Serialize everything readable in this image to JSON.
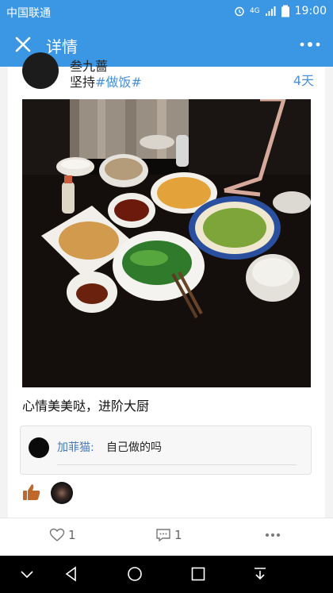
{
  "status_bar": {
    "carrier": "中国联通",
    "time": "19:00",
    "network": "4G"
  },
  "title_bar": {
    "title": "详情"
  },
  "post": {
    "user_name": "叁九蔷",
    "tagline_prefix": "坚持",
    "hashtag": "#做饭#",
    "time_ago": "4天",
    "text": "心情美美哒，进阶大厨"
  },
  "comment": {
    "author": "加菲猫:",
    "text": "自己做的吗"
  },
  "actions": {
    "like_count": "1",
    "comment_count": "1"
  },
  "colors": {
    "brand": "#3b97e3",
    "link": "#4a90d9"
  }
}
